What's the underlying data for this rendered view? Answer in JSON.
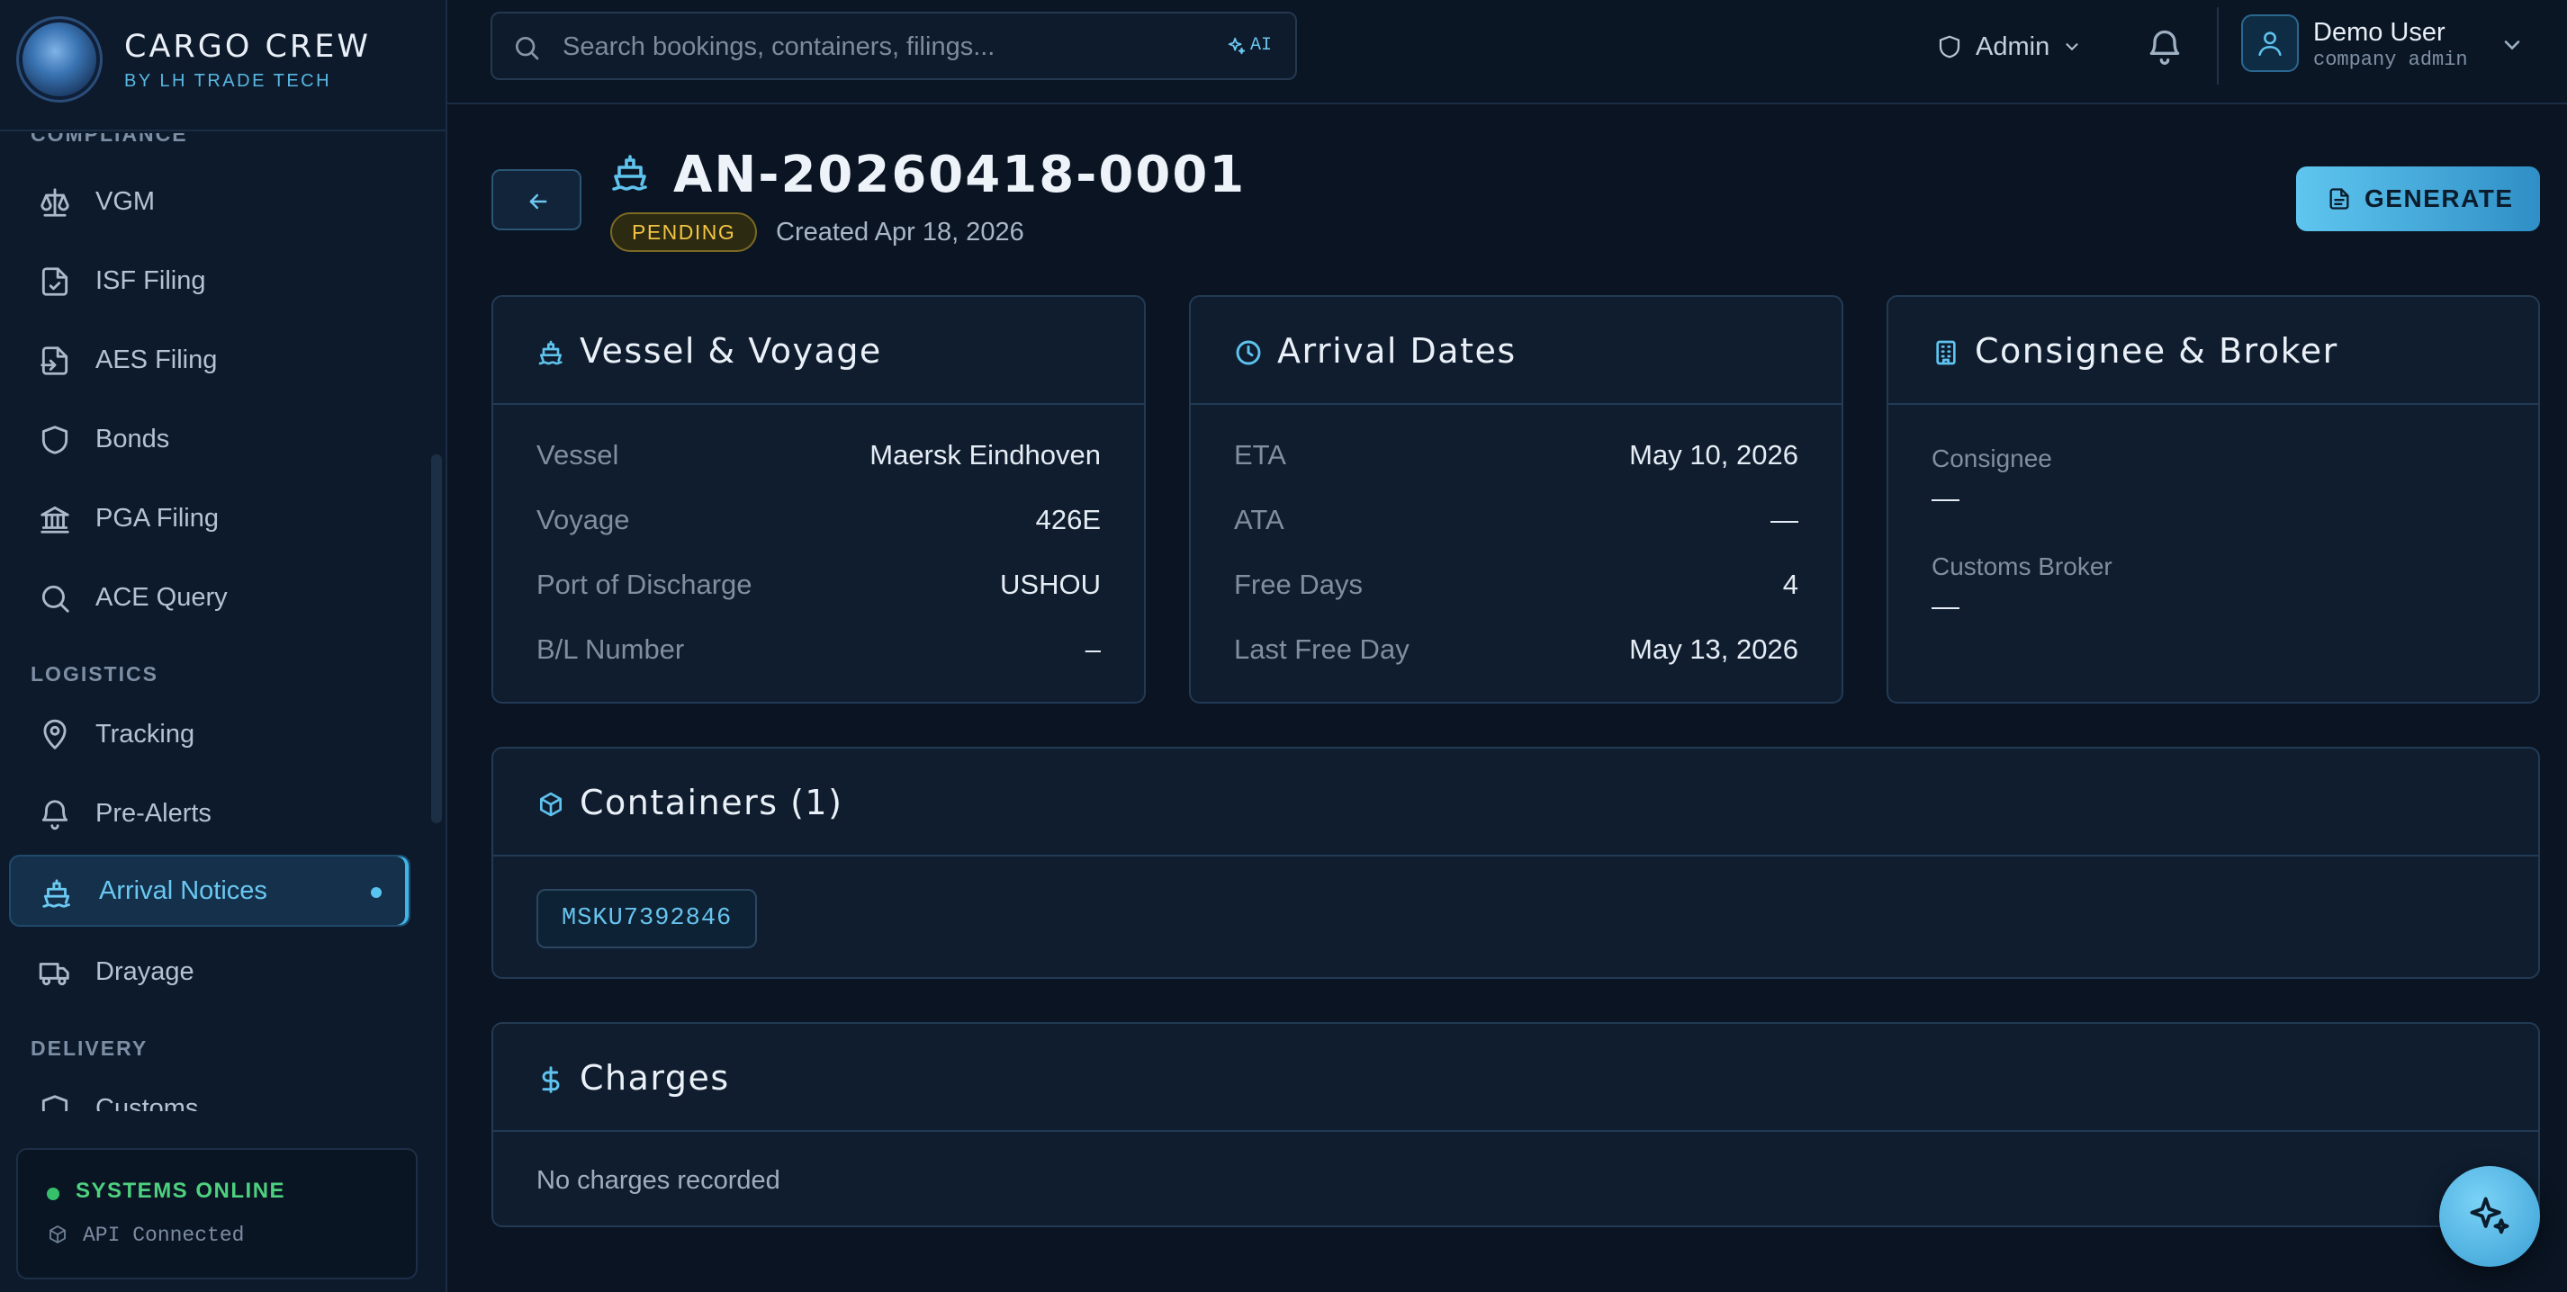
{
  "brand": {
    "name": "CARGO CREW",
    "subtitle": "BY LH TRADE TECH"
  },
  "sidebar": {
    "partial_top_label": "COMPLIANCE",
    "compliance_items": [
      {
        "label": "VGM",
        "icon": "scale-icon"
      },
      {
        "label": "ISF Filing",
        "icon": "file-check-icon"
      },
      {
        "label": "AES Filing",
        "icon": "file-export-icon"
      },
      {
        "label": "Bonds",
        "icon": "shield-icon"
      },
      {
        "label": "PGA Filing",
        "icon": "bank-icon"
      },
      {
        "label": "ACE Query",
        "icon": "search-icon"
      }
    ],
    "logistics_label": "LOGISTICS",
    "logistics_items": [
      {
        "label": "Tracking",
        "icon": "map-pin-icon"
      },
      {
        "label": "Pre-Alerts",
        "icon": "bell-icon"
      },
      {
        "label": "Arrival Notices",
        "icon": "ship-icon",
        "active": true
      },
      {
        "label": "Drayage",
        "icon": "truck-icon"
      }
    ],
    "delivery_label": "DELIVERY",
    "delivery_items": [
      {
        "label": "Customs",
        "icon": "shield-icon"
      }
    ],
    "status": {
      "text": "SYSTEMS ONLINE",
      "api": "API Connected"
    }
  },
  "topbar": {
    "search_placeholder": "Search bookings, containers, filings...",
    "ai_label": "AI",
    "role": "Admin",
    "user_name": "Demo User",
    "user_role": "company admin"
  },
  "header": {
    "title": "AN-20260418-0001",
    "status": "PENDING",
    "created": "Created Apr 18, 2026",
    "generate_label": "GENERATE"
  },
  "vessel_card": {
    "title": "Vessel & Voyage",
    "rows": [
      {
        "k": "Vessel",
        "v": "Maersk Eindhoven"
      },
      {
        "k": "Voyage",
        "v": "426E"
      },
      {
        "k": "Port of Discharge",
        "v": "USHOU"
      },
      {
        "k": "B/L Number",
        "v": "–"
      }
    ]
  },
  "arrival_card": {
    "title": "Arrival Dates",
    "rows": [
      {
        "k": "ETA",
        "v": "May 10, 2026"
      },
      {
        "k": "ATA",
        "v": "—"
      },
      {
        "k": "Free Days",
        "v": "4"
      },
      {
        "k": "Last Free Day",
        "v": "May 13, 2026"
      }
    ]
  },
  "consignee_card": {
    "title": "Consignee & Broker",
    "consignee_label": "Consignee",
    "consignee_value": "—",
    "broker_label": "Customs Broker",
    "broker_value": "—"
  },
  "containers_card": {
    "title": "Containers (1)",
    "items": [
      "MSKU7392846"
    ]
  },
  "charges_card": {
    "title": "Charges",
    "empty_text": "No charges recorded"
  },
  "colors": {
    "accent": "#58c5f0",
    "pending": "#f2c443",
    "online": "#4ed17e",
    "background": "#0a1422"
  }
}
